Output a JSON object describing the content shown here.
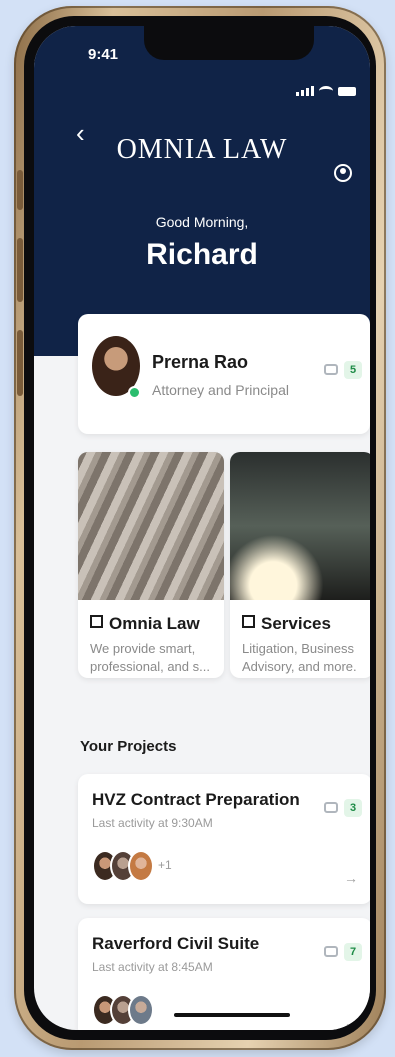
{
  "status_bar": {
    "time": "9:41"
  },
  "header": {
    "brand": "OMNIA LAW",
    "greeting": "Good Morning,",
    "user_name": "Richard"
  },
  "attorney": {
    "name": "Prerna Rao",
    "title": "Attorney and Principal",
    "message_count": "5",
    "online_color": "#2bbd6e"
  },
  "tiles": [
    {
      "title": "Omnia Law",
      "description": "We provide smart, professional, and s..."
    },
    {
      "title": "Services",
      "description": "Litigation, Business Advisory, and more."
    }
  ],
  "projects_section": {
    "title": "Your Projects",
    "items": [
      {
        "title": "HVZ Contract Preparation",
        "activity": "Last activity at 9:30AM",
        "message_count": "3",
        "extra_members": "+1"
      },
      {
        "title": "Raverford Civil Suite",
        "activity": "Last activity at 8:45AM",
        "message_count": "7"
      }
    ]
  },
  "colors": {
    "header_bg": "#102347",
    "accent_green": "#1d8b46",
    "page_bg": "#d3e1f6"
  },
  "icons": [
    "back-chevron-icon",
    "profile-icon",
    "chat-icon",
    "external-link-icon",
    "arrow-right-icon"
  ]
}
